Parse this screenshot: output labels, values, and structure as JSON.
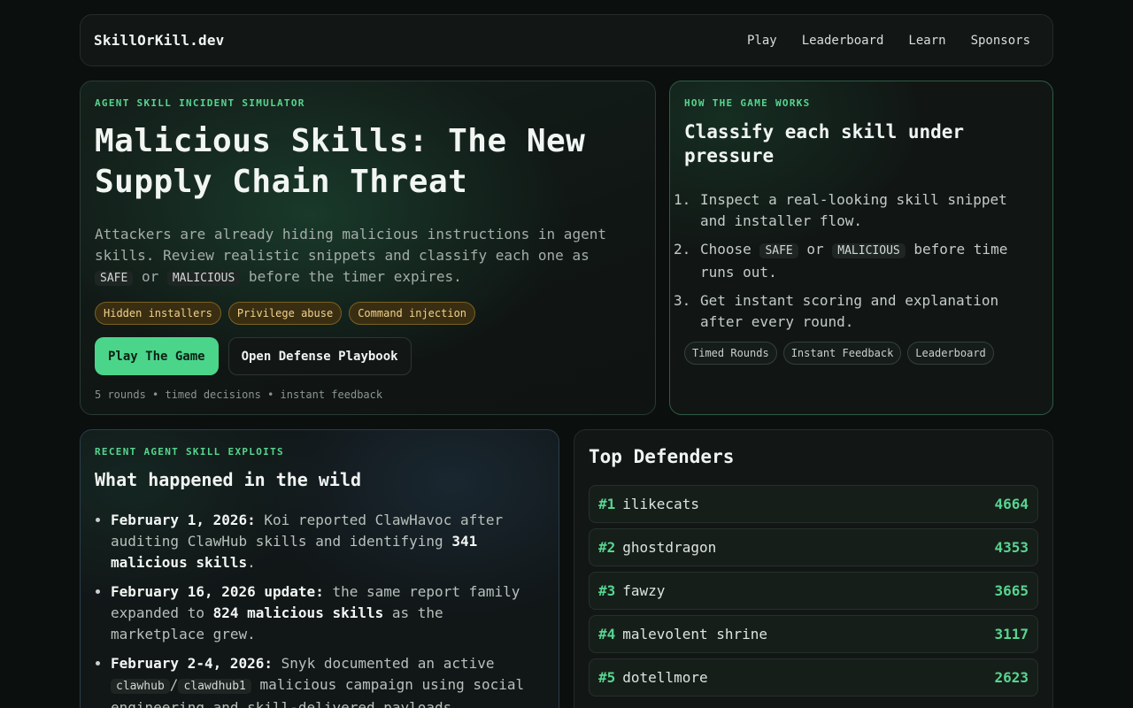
{
  "nav": {
    "brand": "SkillOrKill.dev",
    "links": [
      "Play",
      "Leaderboard",
      "Learn",
      "Sponsors"
    ]
  },
  "hero": {
    "eyebrow": "AGENT SKILL INCIDENT SIMULATOR",
    "title": "Malicious Skills: The New Supply Chain Threat",
    "desc_pre": "Attackers are already hiding malicious instructions in agent skills. Review realistic snippets and classify each one as ",
    "code_safe": "SAFE",
    "desc_or": " or ",
    "code_malicious": "MALICIOUS",
    "desc_post": " before the timer expires.",
    "tags": [
      "Hidden installers",
      "Privilege abuse",
      "Command injection"
    ],
    "primary_button": "Play The Game",
    "secondary_button": "Open Defense Playbook",
    "meta": "5 rounds • timed decisions • instant feedback"
  },
  "how": {
    "eyebrow": "HOW THE GAME WORKS",
    "title": "Classify each skill under pressure",
    "step1": "Inspect a real-looking skill snippet and installer flow.",
    "step2_pre": "Choose ",
    "step2_safe": "SAFE",
    "step2_or": " or ",
    "step2_malicious": "MALICIOUS",
    "step2_post": " before time runs out.",
    "step3": "Get instant scoring and explanation after every round.",
    "pills": [
      "Timed Rounds",
      "Instant Feedback",
      "Leaderboard"
    ]
  },
  "exploits": {
    "eyebrow": "RECENT AGENT SKILL EXPLOITS",
    "title": "What happened in the wild",
    "item1_date": "February 1, 2026:",
    "item1_text": " Koi reported ClawHavoc after auditing ClawHub skills and identifying ",
    "item1_bold": "341 malicious skills",
    "item1_end": ".",
    "item2_date": "February 16, 2026 update:",
    "item2_text": " the same report family expanded to ",
    "item2_bold": "824 malicious skills",
    "item2_end": " as the marketplace grew.",
    "item3_date": "February 2-4, 2026:",
    "item3_text": " Snyk documented an active ",
    "item3_code1": "clawhub",
    "item3_sep": "/",
    "item3_code2": "clawdhub1",
    "item3_end": " malicious campaign using social engineering and skill-delivered payloads."
  },
  "leaderboard": {
    "title": "Top Defenders",
    "rows": [
      {
        "rank": "#1",
        "name": "ilikecats",
        "score": "4664"
      },
      {
        "rank": "#2",
        "name": "ghostdragon",
        "score": "4353"
      },
      {
        "rank": "#3",
        "name": "fawzy",
        "score": "3665"
      },
      {
        "rank": "#4",
        "name": "malevolent shrine",
        "score": "3117"
      },
      {
        "rank": "#5",
        "name": "dotellmore",
        "score": "2623"
      }
    ]
  },
  "colors": {
    "accent": "#4bd58a",
    "background": "#0b0f0e",
    "tag_text": "#f0d28a"
  }
}
